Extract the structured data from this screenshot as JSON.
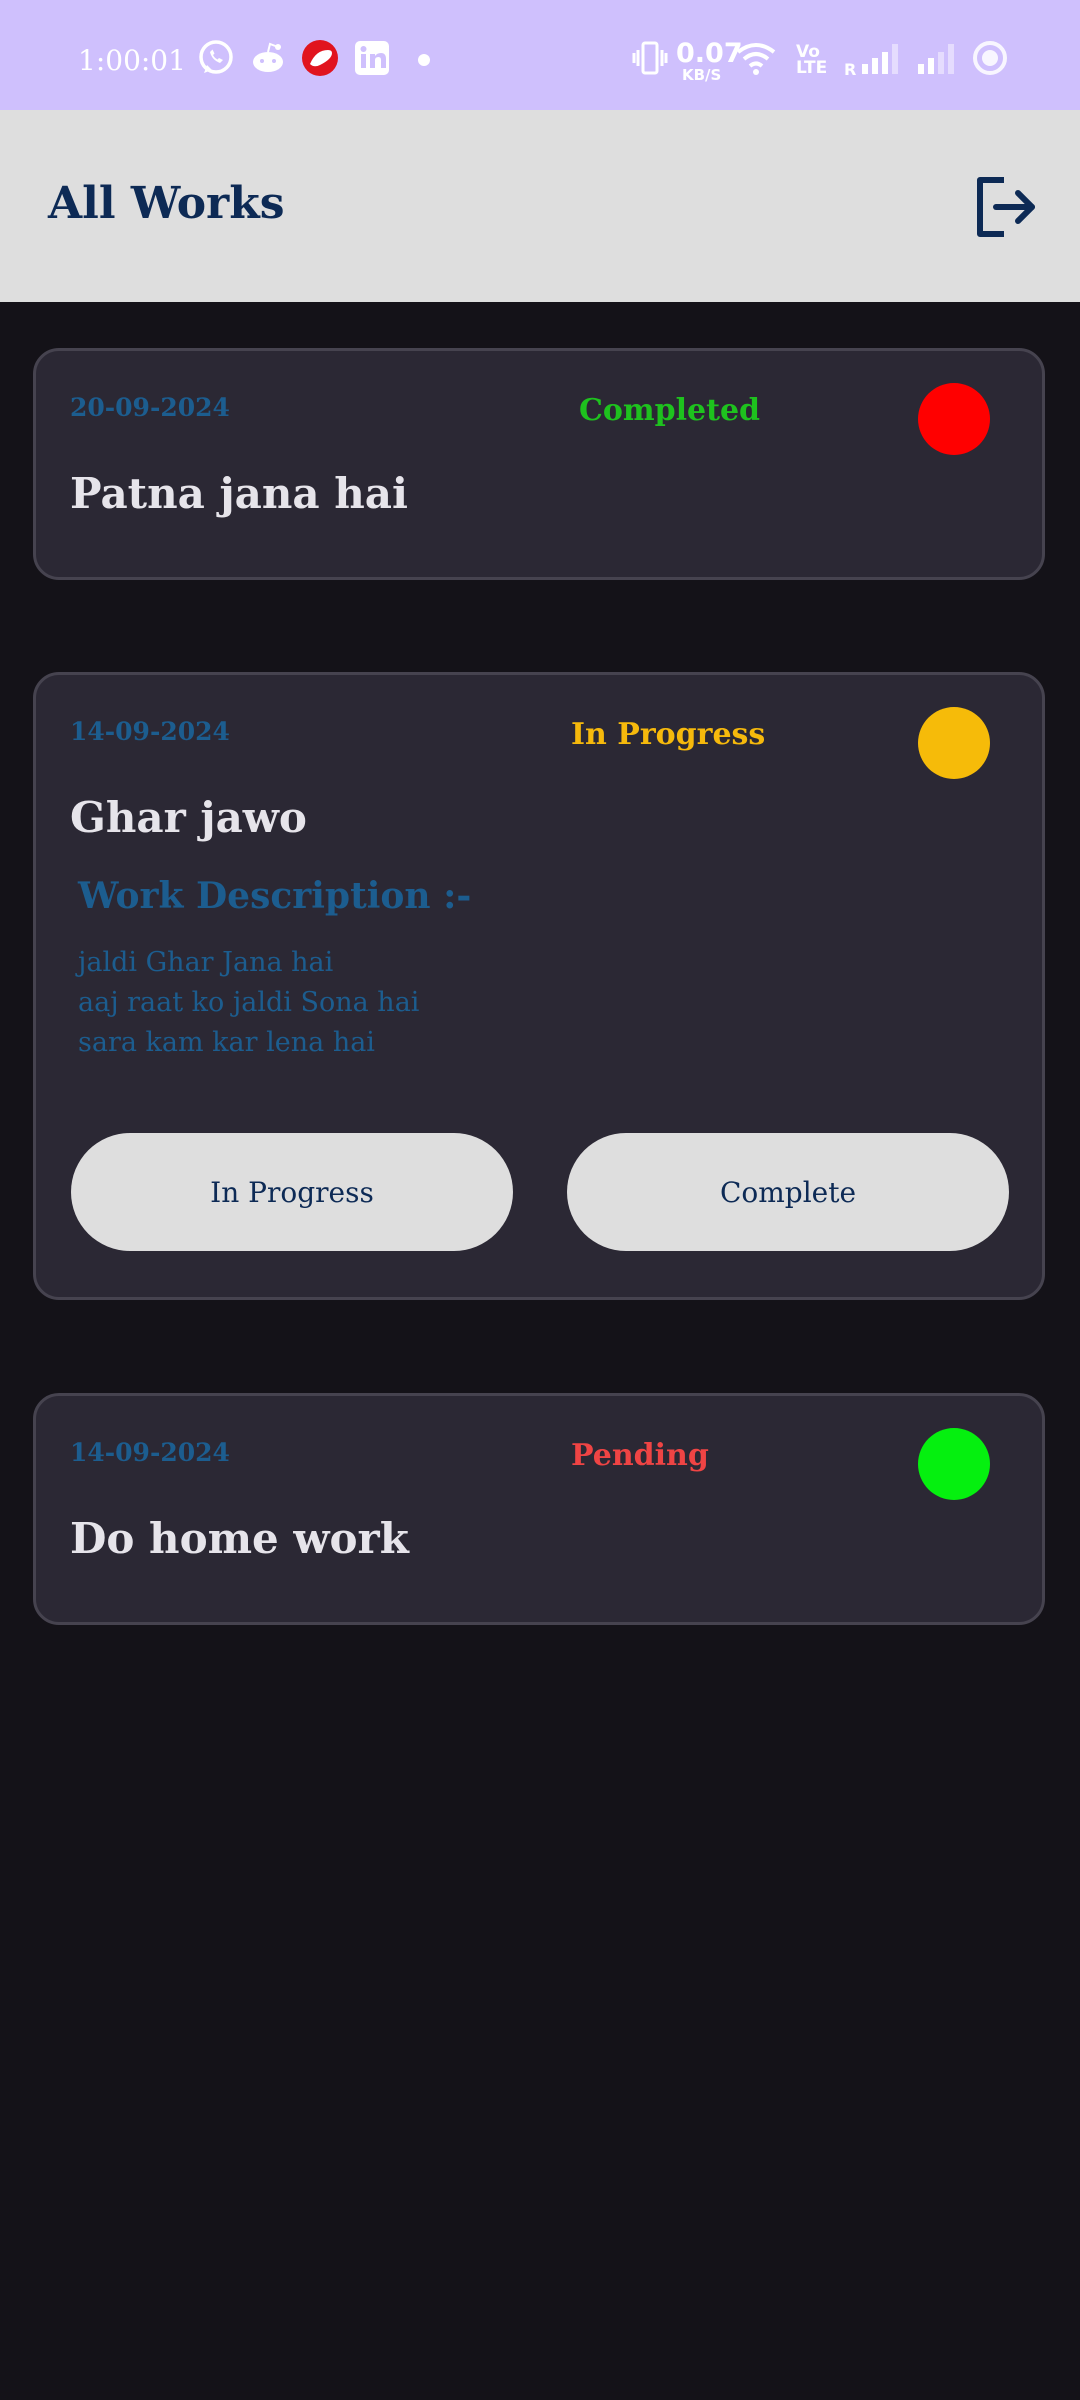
{
  "status_bar": {
    "time": "1:00:01",
    "network_speed_value": "0.07",
    "network_speed_unit": "KB/S",
    "volte_label": "Vo LTE",
    "roaming_label": "R",
    "notification_icons": [
      "whatsapp-icon",
      "reddit-icon",
      "airtel-icon",
      "linkedin-icon",
      "dot-icon"
    ],
    "system_icons": [
      "vibrate-icon",
      "wifi-icon",
      "signal-icon",
      "signal-icon",
      "circle-icon"
    ]
  },
  "app_bar": {
    "title": "All Works",
    "logout_icon": "logout-icon"
  },
  "works": [
    {
      "date": "20-09-2024",
      "status": "Completed",
      "status_color": "#1ec21e",
      "dot_color": "#ff0000",
      "title": "Patna jana hai"
    },
    {
      "date": "14-09-2024",
      "status": "In Progress",
      "status_color": "#f6b90c",
      "dot_color": "#f6bb09",
      "title": "Ghar jawo",
      "description_heading": "Work Description :-",
      "description_lines": [
        "jaldi Ghar Jana hai",
        "aaj raat ko jaldi Sona hai",
        "sara kam kar lena hai"
      ],
      "buttons": {
        "in_progress": "In Progress",
        "complete": "Complete"
      }
    },
    {
      "date": "14-09-2024",
      "status": "Pending",
      "status_color": "#ef4444",
      "dot_color": "#05f00f",
      "title": "Do home work"
    }
  ],
  "colors": {
    "status_bar_bg": "#cfc0fd",
    "app_bar_bg": "#dedede",
    "page_bg": "#141218",
    "card_bg": "#2b2834",
    "accent_text": "#1c5d8f",
    "title_text": "#0d2a55"
  }
}
